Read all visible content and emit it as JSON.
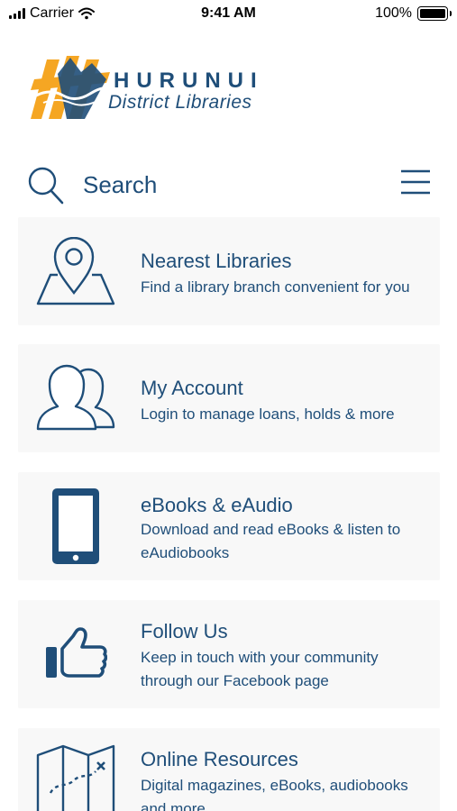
{
  "status": {
    "carrier": "Carrier",
    "time": "9:41 AM",
    "battery": "100%",
    "battery_level": 1.0
  },
  "logo": {
    "title": "HURUNUI",
    "subtitle": "District Libraries",
    "colors": {
      "blue": "#1f4e79",
      "orange": "#f5a623"
    }
  },
  "search": {
    "placeholder": "Search"
  },
  "colors": {
    "primary": "#1f4e79",
    "card_bg": "#f8f8f8"
  },
  "menu": {
    "items": [
      {
        "icon": "map-pin-icon",
        "title": "Nearest Libraries",
        "description": "Find a library branch convenient for you"
      },
      {
        "icon": "users-icon",
        "title": "My Account",
        "description": "Login to manage loans, holds & more"
      },
      {
        "icon": "phone-icon",
        "title": "eBooks & eAudio",
        "description": "Download and read eBooks & listen to eAudiobooks"
      },
      {
        "icon": "thumbs-up-icon",
        "title": "Follow Us",
        "description": "Keep in touch with your community through our Facebook page"
      },
      {
        "icon": "treasure-map-icon",
        "title": "Online Resources",
        "description": "Digital magazines, eBooks, audiobooks and more"
      }
    ]
  }
}
